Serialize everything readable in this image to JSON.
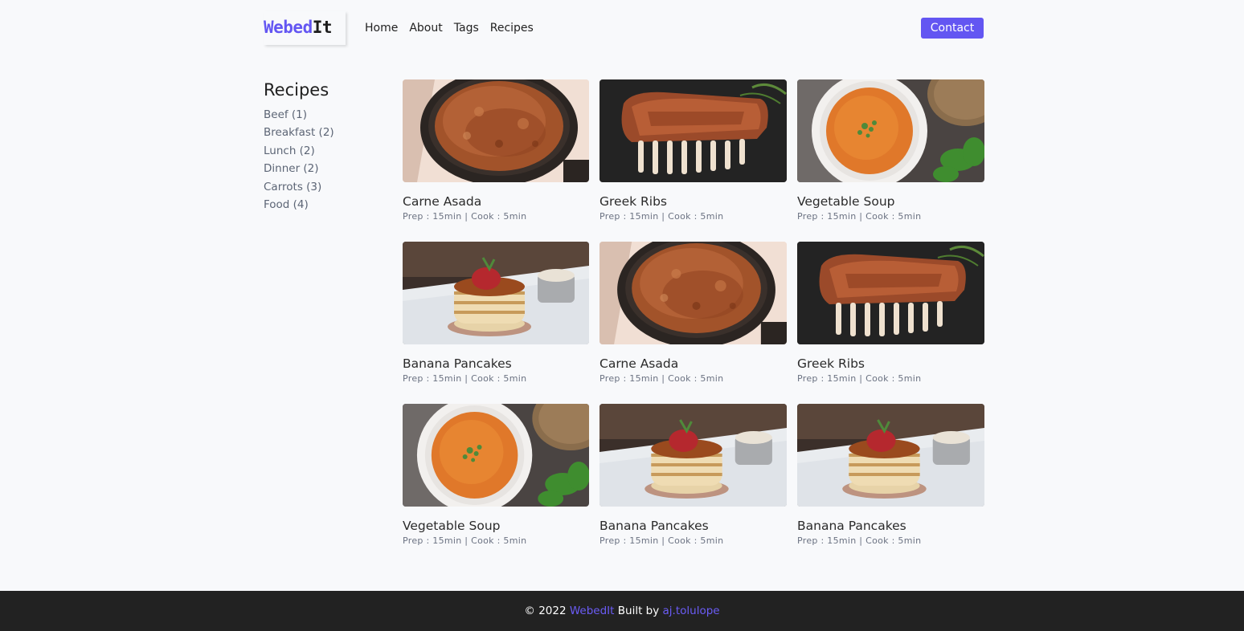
{
  "header": {
    "logo_part1": "Webed",
    "logo_part2": "It",
    "nav": [
      "Home",
      "About",
      "Tags",
      "Recipes"
    ],
    "contact_label": "Contact"
  },
  "sidebar": {
    "title": "Recipes",
    "items": [
      "Beef (1)",
      "Breakfast (2)",
      "Lunch (2)",
      "Dinner (2)",
      "Carrots (3)",
      "Food (4)"
    ]
  },
  "recipes": [
    {
      "title": "Carne Asada",
      "meta": "Prep : 15min | Cook : 5min",
      "image": "carne-asada"
    },
    {
      "title": "Greek Ribs",
      "meta": "Prep : 15min | Cook : 5min",
      "image": "greek-ribs"
    },
    {
      "title": "Vegetable Soup",
      "meta": "Prep : 15min | Cook : 5min",
      "image": "vegetable-soup"
    },
    {
      "title": "Banana Pancakes",
      "meta": "Prep : 15min | Cook : 5min",
      "image": "banana-pancakes"
    },
    {
      "title": "Carne Asada",
      "meta": "Prep : 15min | Cook : 5min",
      "image": "carne-asada"
    },
    {
      "title": "Greek Ribs",
      "meta": "Prep : 15min | Cook : 5min",
      "image": "greek-ribs"
    },
    {
      "title": "Vegetable Soup",
      "meta": "Prep : 15min | Cook : 5min",
      "image": "vegetable-soup"
    },
    {
      "title": "Banana Pancakes",
      "meta": "Prep : 15min | Cook : 5min",
      "image": "banana-pancakes"
    },
    {
      "title": "Banana Pancakes",
      "meta": "Prep : 15min | Cook : 5min",
      "image": "banana-pancakes"
    }
  ],
  "footer": {
    "copyright": "© 2022",
    "brand": "WebedIt",
    "built_by": "Built by",
    "author": "aj.tolulope"
  },
  "colors": {
    "accent": "#6356f2",
    "footer_bg": "#222222",
    "page_bg": "#f8f9fb"
  }
}
